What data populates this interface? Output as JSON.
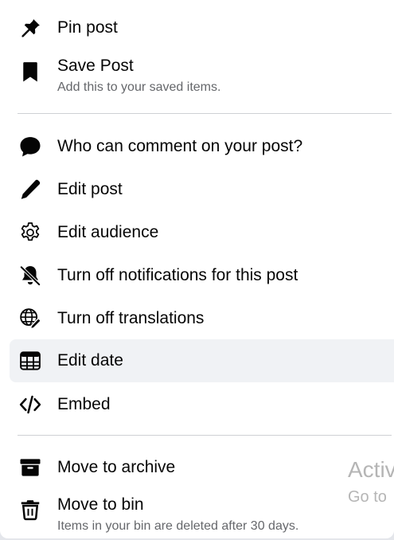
{
  "menu": {
    "items": [
      {
        "name": "pin-post-item",
        "icon": "pin-icon",
        "label": "Pin post"
      },
      {
        "name": "save-post-item",
        "icon": "bookmark-icon",
        "label": "Save Post",
        "sublabel": "Add this to your saved items."
      },
      {
        "name": "who-can-comment-item",
        "icon": "comment-bubble-icon",
        "label": "Who can comment on your post?"
      },
      {
        "name": "edit-post-item",
        "icon": "pencil-icon",
        "label": "Edit post"
      },
      {
        "name": "edit-audience-item",
        "icon": "gear-icon",
        "label": "Edit audience"
      },
      {
        "name": "turn-off-notifications-item",
        "icon": "bell-off-icon",
        "label": "Turn off notifications for this post"
      },
      {
        "name": "turn-off-translations-item",
        "icon": "globe-edit-icon",
        "label": "Turn off translations"
      },
      {
        "name": "edit-date-item",
        "icon": "calendar-table-icon",
        "label": "Edit date"
      },
      {
        "name": "embed-item",
        "icon": "code-icon",
        "label": "Embed"
      },
      {
        "name": "move-to-archive-item",
        "icon": "archive-box-icon",
        "label": "Move to archive"
      },
      {
        "name": "move-to-bin-item",
        "icon": "trash-icon",
        "label": "Move to bin",
        "sublabel": "Items in your bin are deleted after 30 days."
      }
    ]
  },
  "watermark": {
    "line1": "Activ",
    "line2": "Go to"
  },
  "colors": {
    "text_primary": "#050505",
    "text_secondary": "#65676b",
    "hover_bg": "#f0f2f5",
    "divider": "#ced0d4"
  }
}
